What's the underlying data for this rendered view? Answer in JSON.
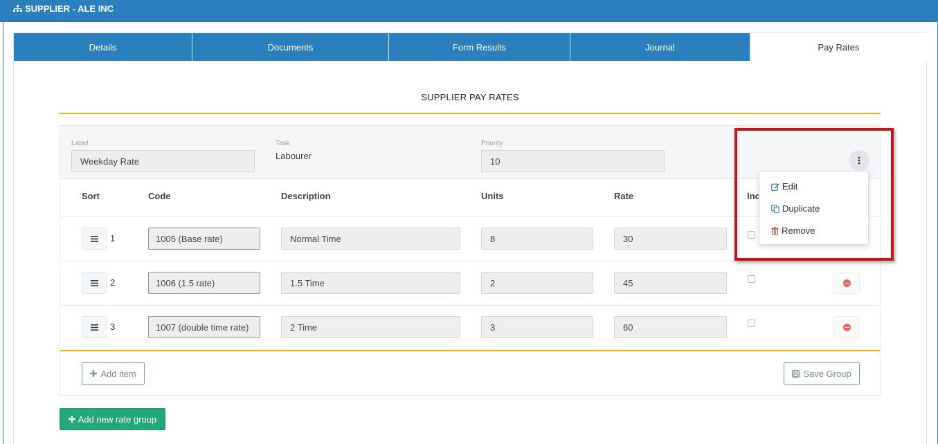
{
  "header": {
    "icon": "sitemap-icon",
    "title": "SUPPLIER - ALE INC"
  },
  "tabs": [
    {
      "label": "Details",
      "active": false
    },
    {
      "label": "Documents",
      "active": false
    },
    {
      "label": "Form Results",
      "active": false
    },
    {
      "label": "Journal",
      "active": false
    },
    {
      "label": "Pay Rates",
      "active": true
    }
  ],
  "section": {
    "title": "SUPPLIER PAY RATES"
  },
  "group": {
    "label_caption": "Label",
    "label_value": "Weekday Rate",
    "task_caption": "Task",
    "task_value": "Labourer",
    "priority_caption": "Priority",
    "priority_value": "10",
    "menu_icon": "vertical-ellipsis-icon"
  },
  "table": {
    "headers": {
      "sort": "Sort",
      "code": "Code",
      "description": "Description",
      "units": "Units",
      "rate": "Rate",
      "inc": "Inc"
    },
    "rows": [
      {
        "sort": "1",
        "code": "1005 (Base rate)",
        "description": "Normal Time",
        "units": "8",
        "rate": "30",
        "included": false
      },
      {
        "sort": "2",
        "code": "1006 (1.5 rate)",
        "description": "1.5 Time",
        "units": "2",
        "rate": "45",
        "included": false
      },
      {
        "sort": "3",
        "code": "1007 (double time rate)",
        "description": "2 Time",
        "units": "3",
        "rate": "60",
        "included": false
      }
    ]
  },
  "buttons": {
    "add_item": "Add item",
    "save_group": "Save Group",
    "add_group": "Add new rate group"
  },
  "dropdown": {
    "items": [
      {
        "label": "Edit",
        "icon": "edit-icon",
        "color": "#2b7fbc"
      },
      {
        "label": "Duplicate",
        "icon": "copy-icon",
        "color": "#2b7fbc"
      },
      {
        "label": "Remove",
        "icon": "trash-icon",
        "color": "#d9534f"
      }
    ]
  },
  "colors": {
    "brand": "#2b7fbc",
    "accent": "#f0ad1f",
    "success": "#22a87b",
    "highlight": "#d40f12"
  }
}
